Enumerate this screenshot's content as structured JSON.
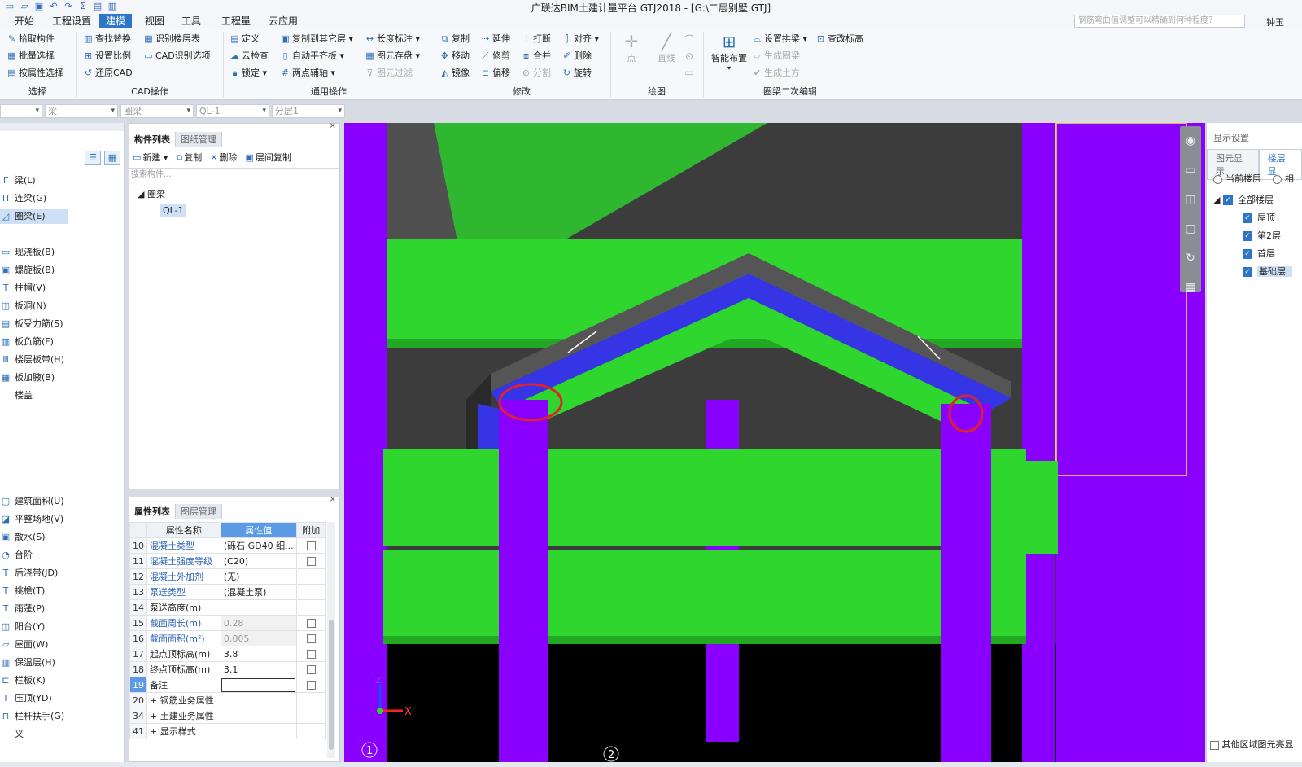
{
  "window": {
    "title": "广联达BIM土建计量平台 GTJ2018 - [G:\\二层别墅.GTJ]"
  },
  "menu": {
    "tabs": [
      "开始",
      "工程设置",
      "建模",
      "视图",
      "工具",
      "工程量",
      "云应用"
    ],
    "active": "建模"
  },
  "search": {
    "placeholder": "钢筋弯曲值调整可以精确到何种程度？"
  },
  "user": {
    "name": "钟玉"
  },
  "ribbon": {
    "select": {
      "items": [
        "拾取构件",
        "批量选择",
        "按属性选择"
      ],
      "label": "选择"
    },
    "cad": {
      "items": [
        "查找替换",
        "识别楼层表",
        "设置比例",
        "CAD识别选项",
        "还原CAD"
      ],
      "label": "CAD操作"
    },
    "common": {
      "items": [
        "定义",
        "复制到其它层",
        "长度标注",
        "云检查",
        "自动平齐板",
        "图元存盘",
        "锁定",
        "两点辅轴",
        "图元过滤"
      ],
      "label": "通用操作"
    },
    "modify": {
      "items": [
        "复制",
        "延伸",
        "打断",
        "对齐",
        "移动",
        "修剪",
        "合并",
        "删除",
        "镜像",
        "偏移",
        "分割",
        "旋转"
      ],
      "label": "修改"
    },
    "draw": {
      "items": [
        "点",
        "直线"
      ],
      "label": "绘图"
    },
    "ring": {
      "big": "智能布置",
      "items": [
        "设置拱梁",
        "查改标高",
        "生成圈梁",
        "生成土方"
      ],
      "label": "圈梁二次编辑"
    }
  },
  "filters": [
    "",
    "梁",
    "圈梁",
    "QL-1",
    "分层1"
  ],
  "leftnav": {
    "items": [
      "梁(L)",
      "连梁(G)",
      "圈梁(E)",
      "现浇板(B)",
      "螺旋板(B)",
      "柱帽(V)",
      "板洞(N)",
      "板受力筋(S)",
      "板负筋(F)",
      "楼层板带(H)",
      "板加腋(B)",
      "楼盖",
      "建筑面积(U)",
      "平整场地(V)",
      "散水(S)",
      "台阶",
      "后浇带(JD)",
      "挑檐(T)",
      "雨蓬(P)",
      "阳台(Y)",
      "屋面(W)",
      "保温层(H)",
      "栏板(K)",
      "压顶(YD)",
      "栏杆扶手(G)",
      "义"
    ],
    "selected": "圈梁(E)"
  },
  "components": {
    "tabs": [
      "构件列表",
      "图纸管理"
    ],
    "tools": [
      "新建",
      "复制",
      "删除",
      "层间复制"
    ],
    "search_placeholder": "搜索构件...",
    "tree": {
      "group": "圈梁",
      "item": "QL-1"
    }
  },
  "properties": {
    "tabs": [
      "属性列表",
      "图层管理"
    ],
    "headers": [
      "属性名称",
      "属性值",
      "附加"
    ],
    "rows": [
      {
        "num": "10",
        "name": "混凝土类型",
        "value": "(砾石 GD40 细...",
        "blue": true,
        "check": true
      },
      {
        "num": "11",
        "name": "混凝土强度等级",
        "value": "(C20)",
        "blue": true,
        "check": true
      },
      {
        "num": "12",
        "name": "混凝土外加剂",
        "value": "(无)",
        "blue": true,
        "check": false
      },
      {
        "num": "13",
        "name": "泵送类型",
        "value": "(混凝土泵)",
        "blue": true,
        "check": false
      },
      {
        "num": "14",
        "name": "泵送高度(m)",
        "value": "",
        "blue": false,
        "check": false
      },
      {
        "num": "15",
        "name": "截面周长(m)",
        "value": "0.28",
        "blue": true,
        "check": true,
        "grey": true
      },
      {
        "num": "16",
        "name": "截面面积(m²)",
        "value": "0.005",
        "blue": true,
        "check": true,
        "grey": true
      },
      {
        "num": "17",
        "name": "起点顶标高(m)",
        "value": "3.8",
        "blue": false,
        "check": true
      },
      {
        "num": "18",
        "name": "终点顶标高(m)",
        "value": "3.1",
        "blue": false,
        "check": true
      },
      {
        "num": "19",
        "name": "备注",
        "value": "",
        "blue": false,
        "check": true,
        "selected": true
      },
      {
        "num": "20",
        "name": "+ 钢筋业务属性",
        "value": "",
        "blue": false,
        "check": false
      },
      {
        "num": "34",
        "name": "+ 土建业务属性",
        "value": "",
        "blue": false,
        "check": false
      },
      {
        "num": "41",
        "name": "+ 显示样式",
        "value": "",
        "blue": false,
        "check": false
      }
    ]
  },
  "display": {
    "title": "显示设置",
    "tabs": [
      "图元显示",
      "楼层显"
    ],
    "radios": [
      "当前楼层",
      "相"
    ],
    "levels": [
      "全部楼层",
      "屋顶",
      "第2层",
      "首层",
      "基础层"
    ],
    "bottom": "其他区域图元亮显"
  },
  "viewport": {
    "axis_x": "X",
    "axis_z": "Z",
    "marker1": "1",
    "marker2": "2"
  },
  "colors": {
    "beam": "#2ed62e",
    "column": "#8a00ff",
    "ringbeam": "#3535e6",
    "slab": "#555555",
    "highlight": "#e0202a"
  }
}
